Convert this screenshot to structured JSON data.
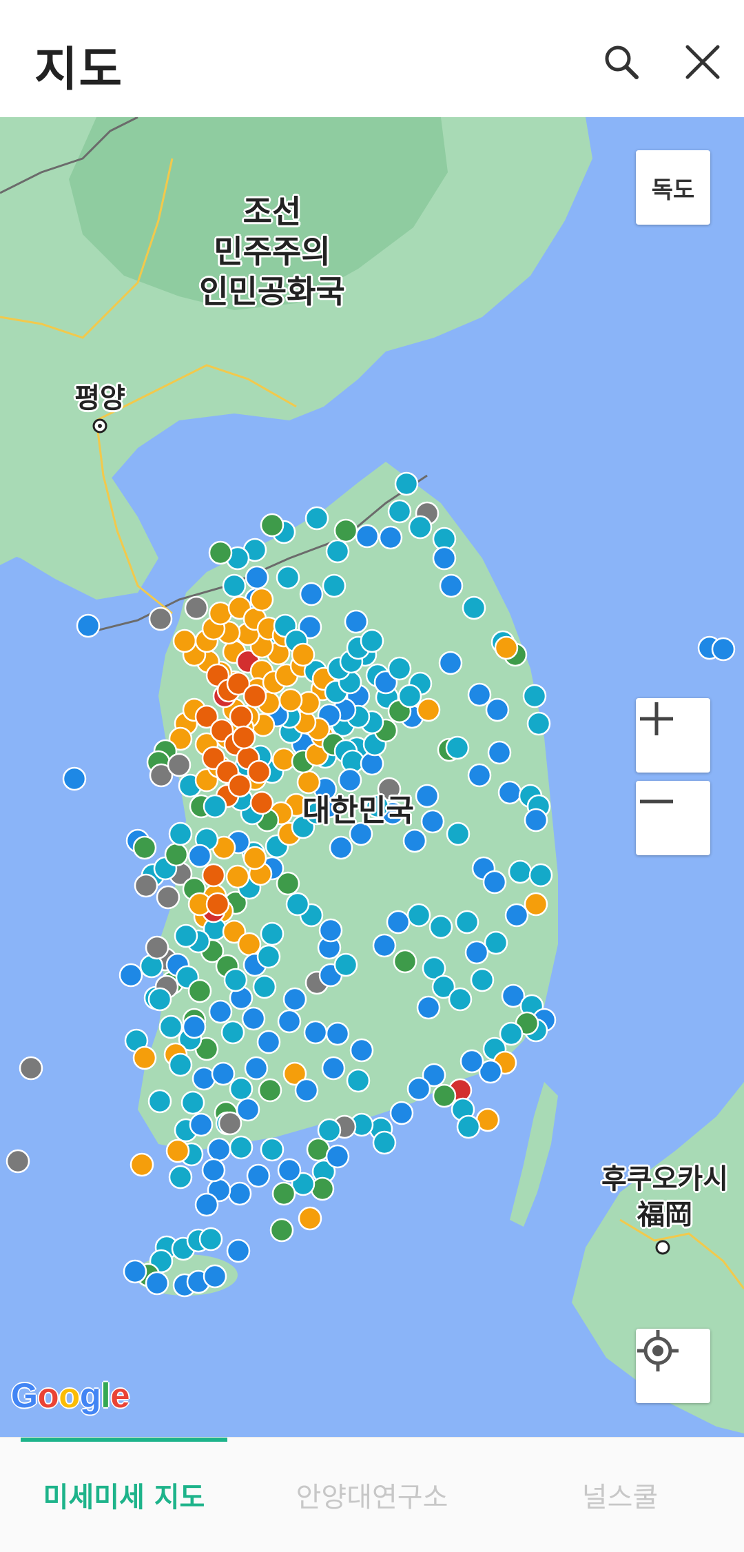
{
  "header": {
    "title": "지도"
  },
  "map": {
    "labels": {
      "north_korea": "조선\n민주주의\n인민공화국",
      "pyongyang": "평양",
      "south_korea": "대한민국",
      "fukuoka": "후쿠오카시\n福岡"
    },
    "dokdo_button": "독도",
    "zoom_in": "+",
    "zoom_out": "−",
    "attribution": "Google",
    "station_colors": {
      "blue": "#1e88e5",
      "cyan": "#14a9c9",
      "green": "#3e9b4a",
      "orange": "#f59e0b",
      "deep_orange": "#e8600a",
      "red": "#d32f2f",
      "gray": "#7a7a7a"
    }
  },
  "tabs": [
    {
      "label": "미세미세 지도",
      "active": true
    },
    {
      "label": "안양대연구소",
      "active": false
    },
    {
      "label": "널스쿨",
      "active": false
    }
  ],
  "colors": {
    "accent": "#1db38a",
    "water": "#8ab4f8",
    "land": "#a8dab5"
  }
}
